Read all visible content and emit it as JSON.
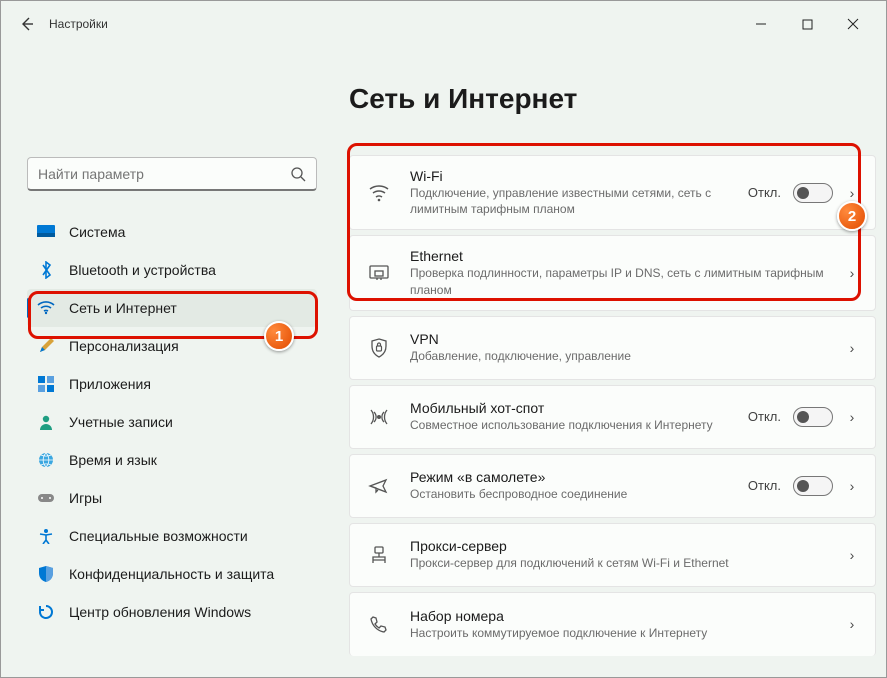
{
  "window": {
    "app_title": "Настройки"
  },
  "search": {
    "placeholder": "Найти параметр"
  },
  "sidebar": {
    "items": [
      {
        "label": "Система"
      },
      {
        "label": "Bluetooth и устройства"
      },
      {
        "label": "Сеть и Интернет"
      },
      {
        "label": "Персонализация"
      },
      {
        "label": "Приложения"
      },
      {
        "label": "Учетные записи"
      },
      {
        "label": "Время и язык"
      },
      {
        "label": "Игры"
      },
      {
        "label": "Специальные возможности"
      },
      {
        "label": "Конфиденциальность и защита"
      },
      {
        "label": "Центр обновления Windows"
      }
    ]
  },
  "page": {
    "title": "Сеть и Интернет"
  },
  "cards": [
    {
      "title": "Wi-Fi",
      "sub": "Подключение, управление известными сетями, сеть с лимитным тарифным планом",
      "state": "Откл.",
      "toggle": true
    },
    {
      "title": "Ethernet",
      "sub": "Проверка подлинности, параметры IP и DNS, сеть с лимитным тарифным планом",
      "toggle": false
    },
    {
      "title": "VPN",
      "sub": "Добавление, подключение, управление",
      "toggle": false
    },
    {
      "title": "Мобильный хот-спот",
      "sub": "Совместное использование подключения к Интернету",
      "state": "Откл.",
      "toggle": true
    },
    {
      "title": "Режим «в самолете»",
      "sub": "Остановить беспроводное соединение",
      "state": "Откл.",
      "toggle": true
    },
    {
      "title": "Прокси-сервер",
      "sub": "Прокси-сервер для подключений к сетям Wi-Fi и Ethernet",
      "toggle": false
    },
    {
      "title": "Набор номера",
      "sub": "Настроить коммутируемое подключение к Интернету",
      "toggle": false
    }
  ],
  "annotations": {
    "badge1": "1",
    "badge2": "2"
  }
}
